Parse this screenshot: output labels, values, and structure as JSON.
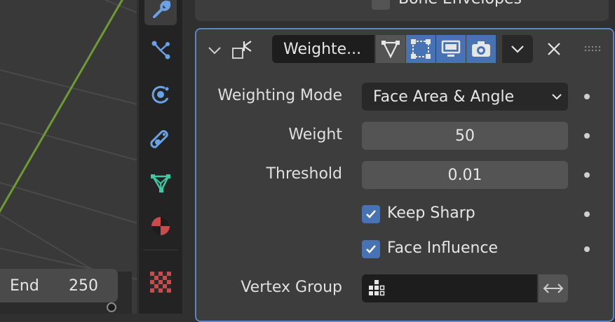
{
  "timeline": {
    "end_label": "End",
    "end_value": "250"
  },
  "previous_panel": {
    "label": "Bone Envelopes"
  },
  "modifier": {
    "name": "Weighte...",
    "weighting_mode": {
      "label": "Weighting Mode",
      "value": "Face Area & Angle"
    },
    "weight": {
      "label": "Weight",
      "value": "50"
    },
    "threshold": {
      "label": "Threshold",
      "value": "0.01"
    },
    "keep_sharp": {
      "label": "Keep Sharp",
      "checked": true
    },
    "face_influence": {
      "label": "Face Influence",
      "checked": true
    },
    "vertex_group": {
      "label": "Vertex Group",
      "value": ""
    }
  },
  "colors": {
    "accent": "#4772b3",
    "modifier_border": "#5b86c0",
    "background": "#303030"
  }
}
